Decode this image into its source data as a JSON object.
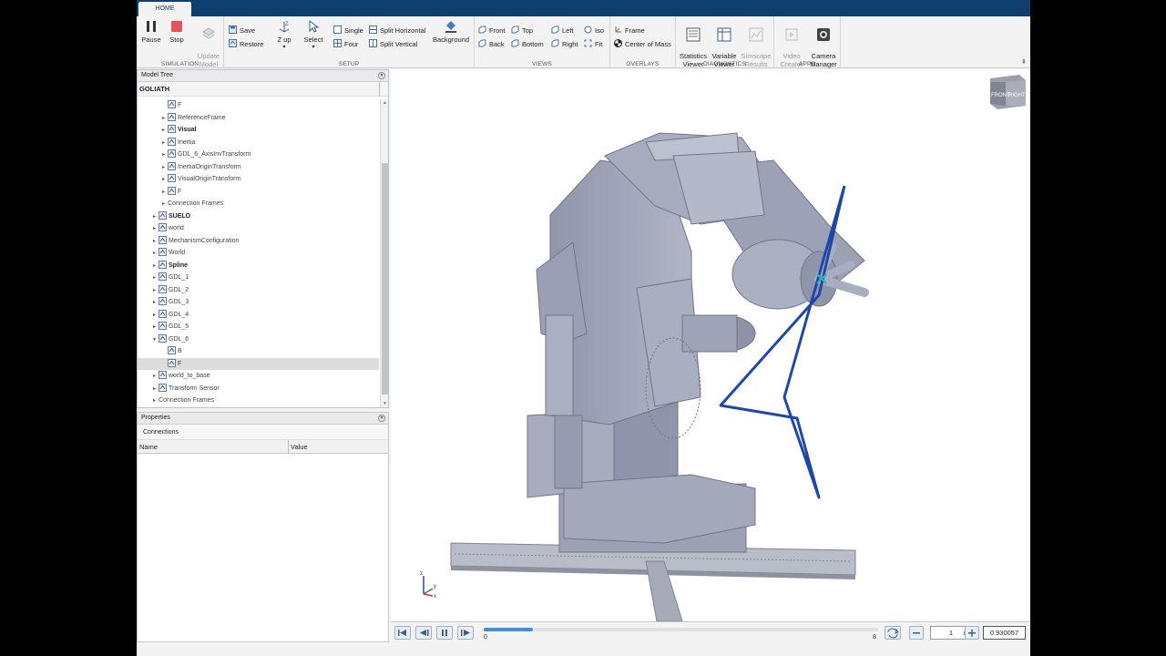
{
  "tabs": [
    {
      "label": "HOME"
    }
  ],
  "ribbon": {
    "simulation": {
      "label": "SIMULATION",
      "pause": "Pause",
      "stop": "Stop",
      "update_model": "Update\nModel"
    },
    "setup": {
      "label": "SETUP",
      "save": "Save",
      "restore": "Restore",
      "zup": "Z up",
      "select": "Select",
      "single": "Single",
      "four": "Four",
      "split_horizontal": "Split Horizontal",
      "split_vertical": "Split Vertical",
      "background": "Background"
    },
    "views": {
      "label": "VIEWS",
      "front": "Front",
      "back": "Back",
      "top": "Top",
      "bottom": "Bottom",
      "left": "Left",
      "right": "Right",
      "iso": "Iso",
      "fit": "Fit"
    },
    "overlays": {
      "label": "OVERLAYS",
      "frame": "Frame",
      "center_of_mass": "Center of Mass"
    },
    "diagnostics": {
      "label": "DIAGNOSTICS",
      "statistics_viewer": "Statistics\nViewer",
      "variable_viewer": "Variable\nViewer",
      "simscape_results": "Simscape\nResults"
    },
    "apps": {
      "label": "APPS",
      "video_creator": "Video\nCreator",
      "camera_manager": "Camera\nManager"
    }
  },
  "model_tree": {
    "title": "Model Tree",
    "root": "GOLIATH",
    "rows": [
      {
        "label": "F",
        "indent": 2,
        "arrow": "",
        "icon": "frame-icon",
        "bold": false,
        "selected": false
      },
      {
        "label": "ReferenceFrame",
        "indent": 2,
        "arrow": "▸",
        "icon": "frame-axes-icon",
        "bold": false,
        "selected": false
      },
      {
        "label": "Visual",
        "indent": 2,
        "arrow": "▸",
        "icon": "cube-icon",
        "bold": true,
        "selected": false
      },
      {
        "label": "Inertia",
        "indent": 2,
        "arrow": "▸",
        "icon": "inertia-icon",
        "bold": false,
        "selected": false
      },
      {
        "label": "GDL_6_AxisInvTransform",
        "indent": 2,
        "arrow": "▸",
        "icon": "transform-icon",
        "bold": false,
        "selected": false
      },
      {
        "label": "InertiaOriginTransform",
        "indent": 2,
        "arrow": "▸",
        "icon": "transform-icon",
        "bold": false,
        "selected": false
      },
      {
        "label": "VisualOriginTransform",
        "indent": 2,
        "arrow": "▸",
        "icon": "transform-icon",
        "bold": false,
        "selected": false
      },
      {
        "label": "F",
        "indent": 2,
        "arrow": "▸",
        "icon": "frame-axes-icon",
        "bold": false,
        "selected": false
      },
      {
        "label": "Connection Frames",
        "indent": 2,
        "arrow": "▸",
        "icon": "",
        "bold": false,
        "selected": false
      },
      {
        "label": "SUELO",
        "indent": 1,
        "arrow": "▸",
        "icon": "subsystem-icon",
        "bold": true,
        "selected": false
      },
      {
        "label": "world",
        "indent": 1,
        "arrow": "▸",
        "icon": "subsystem-icon",
        "bold": false,
        "selected": false
      },
      {
        "label": "MechanismConfiguration",
        "indent": 1,
        "arrow": "▸",
        "icon": "gear-icon",
        "bold": false,
        "selected": false
      },
      {
        "label": "World",
        "indent": 1,
        "arrow": "▸",
        "icon": "world-icon",
        "bold": false,
        "selected": false
      },
      {
        "label": "Spline",
        "indent": 1,
        "arrow": "▸",
        "icon": "spline-icon",
        "bold": true,
        "selected": false
      },
      {
        "label": "GDL_1",
        "indent": 1,
        "arrow": "▸",
        "icon": "joint-icon",
        "bold": false,
        "selected": false
      },
      {
        "label": "GDL_2",
        "indent": 1,
        "arrow": "▸",
        "icon": "joint-icon",
        "bold": false,
        "selected": false
      },
      {
        "label": "GDL_3",
        "indent": 1,
        "arrow": "▸",
        "icon": "joint-icon",
        "bold": false,
        "selected": false
      },
      {
        "label": "GDL_4",
        "indent": 1,
        "arrow": "▸",
        "icon": "joint-icon",
        "bold": false,
        "selected": false
      },
      {
        "label": "GDL_5",
        "indent": 1,
        "arrow": "▸",
        "icon": "joint-icon",
        "bold": false,
        "selected": false
      },
      {
        "label": "GDL_6",
        "indent": 1,
        "arrow": "▾",
        "icon": "joint-icon",
        "bold": false,
        "selected": false
      },
      {
        "label": "B",
        "indent": 2,
        "arrow": "",
        "icon": "frame-icon",
        "bold": false,
        "selected": false
      },
      {
        "label": "F",
        "indent": 2,
        "arrow": "",
        "icon": "frame-icon",
        "bold": false,
        "selected": true
      },
      {
        "label": "world_to_base",
        "indent": 1,
        "arrow": "▸",
        "icon": "weld-icon",
        "bold": false,
        "selected": false
      },
      {
        "label": "Transform Sensor",
        "indent": 1,
        "arrow": "▸",
        "icon": "sensor-icon",
        "bold": false,
        "selected": false
      },
      {
        "label": "Connection Frames",
        "indent": 1,
        "arrow": "▸",
        "icon": "",
        "bold": false,
        "selected": false
      }
    ]
  },
  "properties": {
    "title": "Properties",
    "tab": "Connections",
    "columns": [
      "Name",
      "Value"
    ]
  },
  "viewcube": {
    "front": "FRONT",
    "right": "RIGHT"
  },
  "triad": {
    "z": "z",
    "y": "y",
    "x": "x"
  },
  "playback": {
    "progress": 0.125,
    "start_label": "0",
    "end_label": "8",
    "speed": "1",
    "speed_unit": "x",
    "time": "0.930057"
  },
  "colors": {
    "tab_strip": "#0e3f6f",
    "robot_body": "#9fa6ba",
    "spline": "#1f47a8",
    "timeline_fill": "#3f8fdc"
  }
}
